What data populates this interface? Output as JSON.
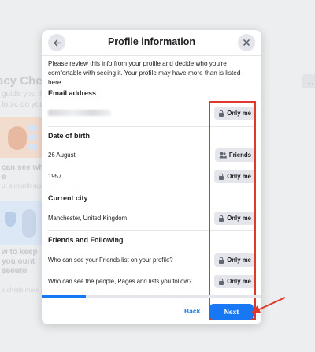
{
  "background": {
    "title": "acy Chec",
    "subtitle": "guide you th topic do you",
    "card1_title": "can see wha e",
    "card1_meta": "ut a month ago",
    "card2_title": "w to keep you ount secure",
    "card2_meta": "days ago",
    "footer": "e check more p",
    "side_button": "..."
  },
  "modal": {
    "title": "Profile information",
    "intro": "Please review this info from your profile and decide who you're comfortable with seeing it. Your profile may have more than is listed here.",
    "sections": {
      "email": {
        "title": "Email address",
        "audience": "Only me"
      },
      "dob": {
        "title": "Date of birth",
        "day_label": "26 August",
        "day_audience": "Friends",
        "year_label": "1957",
        "year_audience": "Only me"
      },
      "city": {
        "title": "Current city",
        "label": "Manchester, United Kingdom",
        "audience": "Only me"
      },
      "friends": {
        "title": "Friends and Following",
        "q1": "Who can see your Friends list on your profile?",
        "q1_audience": "Only me",
        "q2": "Who can see the people, Pages and lists you follow?",
        "q2_audience": "Only me"
      }
    },
    "progress": 0.2,
    "back_label": "Back",
    "next_label": "Next"
  },
  "colors": {
    "accent": "#1877f2",
    "highlight": "#e0392b"
  }
}
